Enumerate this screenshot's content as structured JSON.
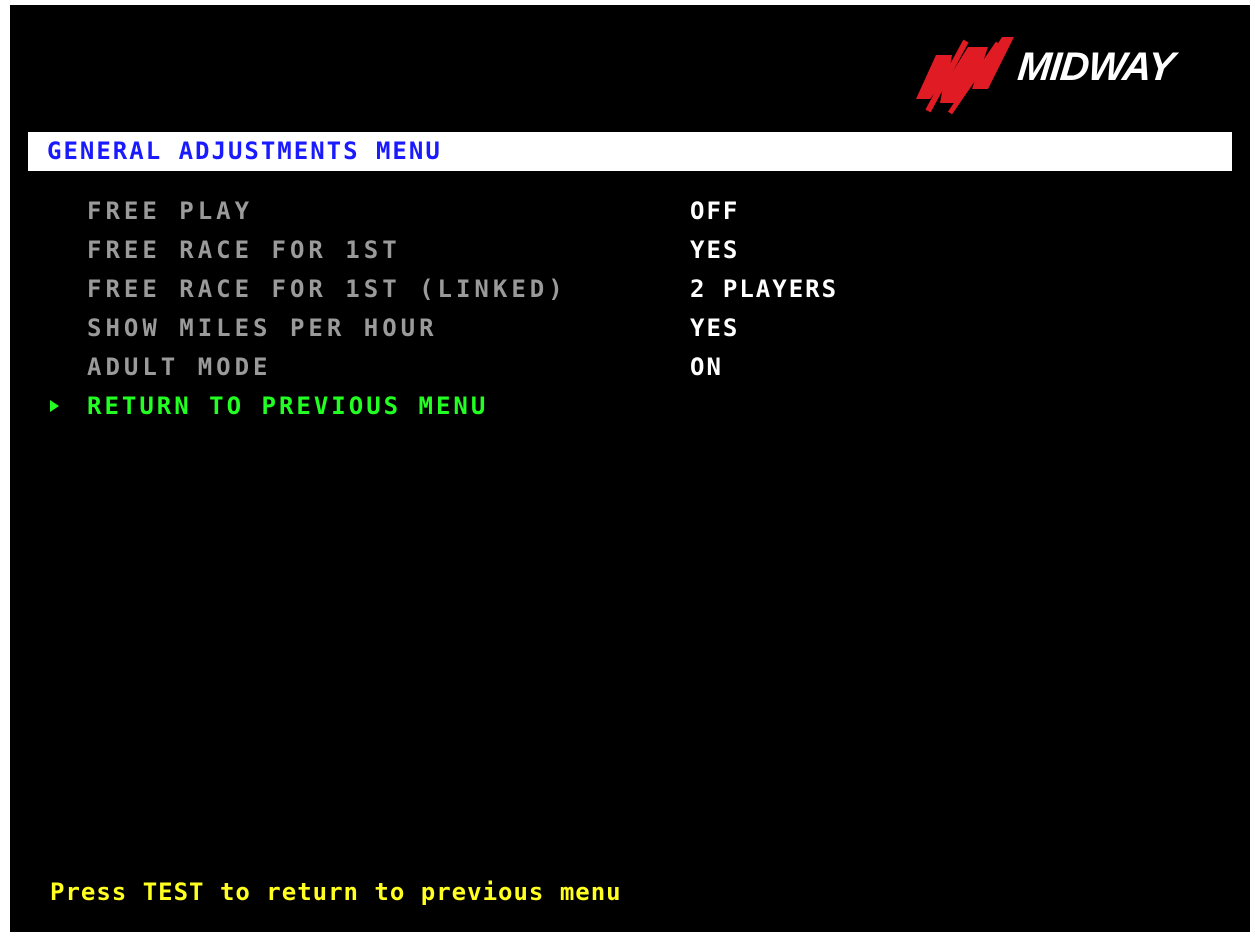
{
  "brand": {
    "logo_text": "MIDWAY",
    "logo_icon": "midway-m-icon"
  },
  "header": {
    "title": "GENERAL ADJUSTMENTS MENU"
  },
  "menu": {
    "items": [
      {
        "label": "FREE PLAY",
        "value": "OFF"
      },
      {
        "label": "FREE RACE FOR 1ST",
        "value": "YES"
      },
      {
        "label": "FREE RACE FOR 1ST (LINKED)",
        "value": "2 PLAYERS"
      },
      {
        "label": "SHOW MILES PER HOUR",
        "value": "YES"
      },
      {
        "label": "ADULT MODE",
        "value": "ON"
      }
    ],
    "return_label": "RETURN TO PREVIOUS MENU",
    "cursor_icon": "selection-arrow-icon"
  },
  "footer": {
    "hint": "Press TEST to return to previous menu"
  },
  "colors": {
    "background": "#000000",
    "header_bar": "#ffffff",
    "header_text": "#1a1aff",
    "label": "#9a9a9a",
    "value": "#ffffff",
    "selected": "#22ff22",
    "footer": "#ffff22",
    "logo_red": "#e01b24"
  }
}
